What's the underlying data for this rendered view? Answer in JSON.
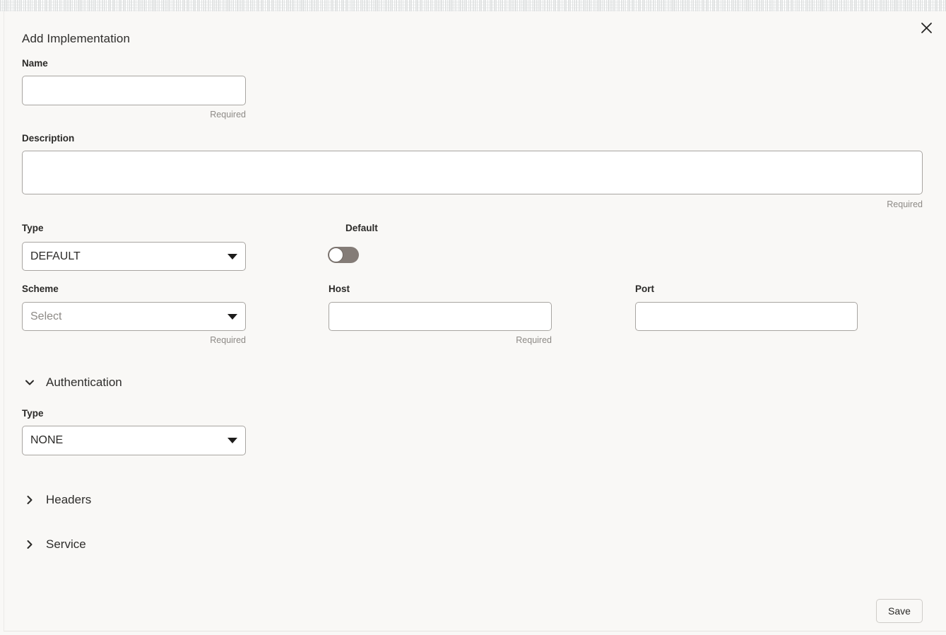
{
  "dialog": {
    "title": "Add Implementation",
    "close_icon": "close-icon"
  },
  "fields": {
    "name": {
      "label": "Name",
      "value": "",
      "placeholder": "",
      "helper": "Required"
    },
    "description": {
      "label": "Description",
      "value": "",
      "placeholder": "",
      "helper": "Required"
    },
    "type": {
      "label": "Type",
      "value": "DEFAULT",
      "options": [
        "DEFAULT"
      ]
    },
    "default_toggle": {
      "label": "Default",
      "state": "off"
    },
    "scheme": {
      "label": "Scheme",
      "value": "Select",
      "is_placeholder": true,
      "helper": "Required",
      "options": [
        "Select"
      ]
    },
    "host": {
      "label": "Host",
      "value": "",
      "placeholder": "",
      "helper": "Required"
    },
    "port": {
      "label": "Port",
      "value": "",
      "placeholder": "",
      "helper": ""
    }
  },
  "sections": {
    "authentication": {
      "title": "Authentication",
      "expanded": true,
      "chevron": "chevron-down-icon",
      "type": {
        "label": "Type",
        "value": "NONE",
        "options": [
          "NONE"
        ]
      }
    },
    "headers": {
      "title": "Headers",
      "expanded": false,
      "chevron": "chevron-right-icon"
    },
    "service": {
      "title": "Service",
      "expanded": false,
      "chevron": "chevron-right-icon"
    }
  },
  "footer": {
    "save_label": "Save"
  },
  "colors": {
    "background": "#f9f8f6",
    "input_border": "#a8a5a1",
    "text": "#262524",
    "muted_text": "#8d8a86",
    "toggle_track": "#847c77"
  }
}
